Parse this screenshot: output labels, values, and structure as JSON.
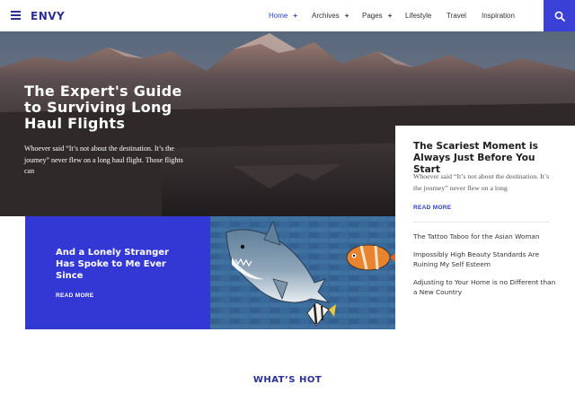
{
  "header": {
    "logo": "ENVY",
    "nav": [
      {
        "label": "Home",
        "has_submenu": true,
        "active": true
      },
      {
        "label": "Archives",
        "has_submenu": true,
        "active": false
      },
      {
        "label": "Pages",
        "has_submenu": true,
        "active": false
      },
      {
        "label": "Lifestyle",
        "has_submenu": false,
        "active": false
      },
      {
        "label": "Travel",
        "has_submenu": false,
        "active": false
      },
      {
        "label": "Inspiration",
        "has_submenu": false,
        "active": false
      }
    ],
    "submenu_glyph": "+",
    "icons": {
      "menu": "hamburger-menu-icon",
      "search": "search-icon"
    }
  },
  "hero": {
    "title": "The Expert's Guide to Surviving Long Haul Flights",
    "excerpt": "Whoever said “It’s not about the destination. It’s the journey” never flew on a long haul flight. Those flights can"
  },
  "side_card": {
    "title": "The Scariest Moment is Always Just Before You Start",
    "excerpt": "Whoever said “It’s not about the destination. It’s the journey” never flew on a long",
    "read_more": "READ MORE",
    "links": [
      "The Tattoo Taboo for the Asian Woman",
      "Impossibly High Beauty Standards Are Ruining My Self Esteem",
      "Adjusting to Your Home is no Different than a New Country"
    ]
  },
  "blue_card": {
    "title": "And a Lonely Stranger Has Spoke to Me Ever Since",
    "read_more": "READ MORE"
  },
  "section": {
    "heading": "WHAT’S HOT"
  },
  "colors": {
    "brand": "#2a2f96",
    "accent": "#3b40d6",
    "card_blue": "#3338d4"
  }
}
